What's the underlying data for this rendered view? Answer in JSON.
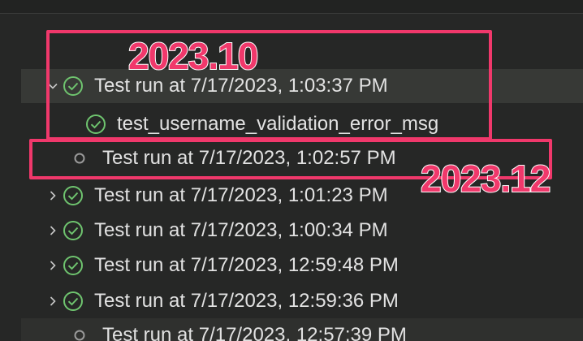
{
  "test_explorer": {
    "rows": [
      {
        "label": "Test run at 7/17/2023, 1:03:37 PM",
        "status": "passed",
        "expanded": true
      },
      {
        "label": "test_username_validation_error_msg",
        "status": "passed",
        "child": true
      },
      {
        "label": "Test run at 7/17/2023, 1:02:57 PM",
        "status": "not-run"
      },
      {
        "label": "Test run at 7/17/2023, 1:01:23 PM",
        "status": "passed",
        "expanded": false
      },
      {
        "label": "Test run at 7/17/2023, 1:00:34 PM",
        "status": "passed",
        "expanded": false
      },
      {
        "label": "Test run at 7/17/2023, 12:59:48 PM",
        "status": "passed",
        "expanded": false
      },
      {
        "label": "Test run at 7/17/2023, 12:59:36 PM",
        "status": "passed",
        "expanded": false
      },
      {
        "label": "Test run at 7/17/2023, 12:57:39 PM",
        "status": "not-run"
      }
    ]
  },
  "annotations": {
    "label_a": "2023.10",
    "label_b": "2023.12"
  },
  "colors": {
    "passed": "#6fc46f",
    "not_run": "#9a9a9a",
    "annotation": "#f0386b",
    "text": "#e2e2e2"
  }
}
